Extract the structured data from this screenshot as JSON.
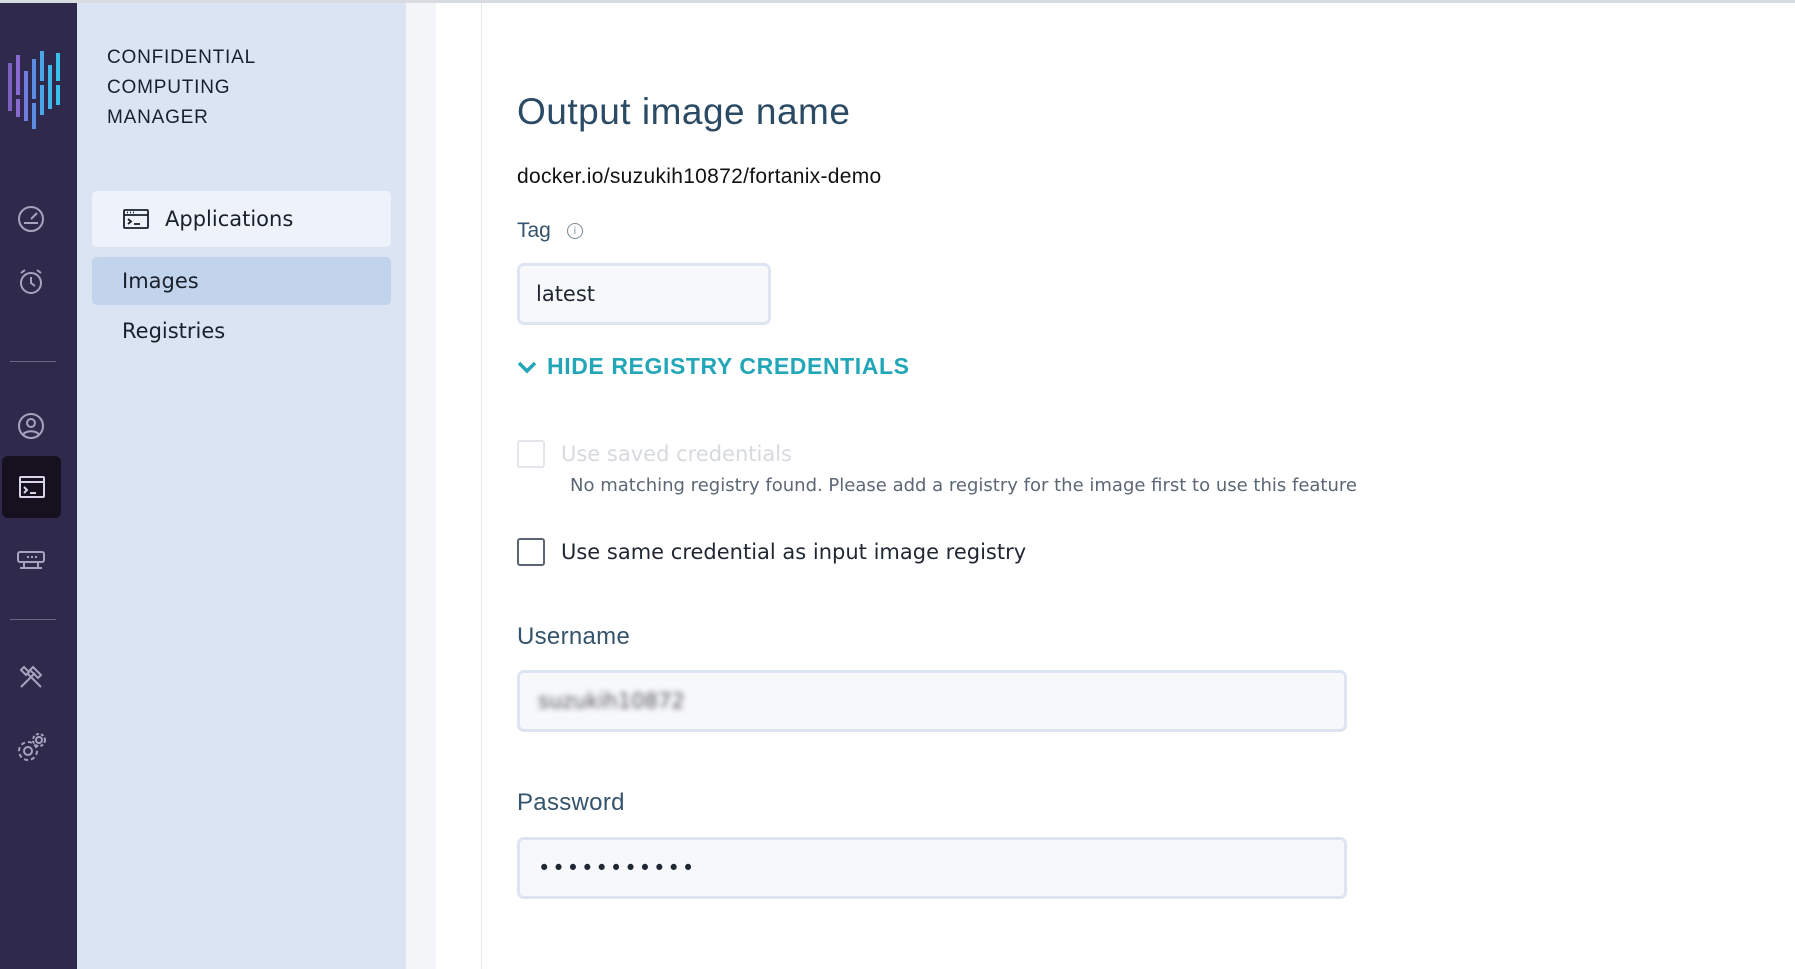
{
  "brand": {
    "lines": [
      "CONFIDENTIAL",
      "COMPUTING",
      "MANAGER"
    ]
  },
  "rail": {
    "icons": [
      "dashboard-icon",
      "alarm-icon",
      "user-icon",
      "applications-icon",
      "compute-node-icon",
      "tools-icon",
      "settings-icon"
    ],
    "active": "applications-icon"
  },
  "sidebar": {
    "items": [
      {
        "label": "Applications",
        "icon": "terminal-window-icon"
      },
      {
        "label": "Images",
        "selected": true
      },
      {
        "label": "Registries"
      }
    ]
  },
  "form": {
    "section_title": "Output image name",
    "repository": "docker.io/suzukih10872/fortanix-demo",
    "tag_label": "Tag",
    "tag_value": "latest",
    "toggle_label": "HIDE REGISTRY CREDENTIALS",
    "use_saved_label": "Use saved credentials",
    "use_saved_helper": "No matching registry found. Please add a registry for the image first to use this feature",
    "same_credential_label": "Use same credential as input image registry",
    "username_label": "Username",
    "username_value": "suzukih10872",
    "password_label": "Password",
    "password_value": "•••••••••••"
  },
  "colors": {
    "rail_bg": "#2f2a4b",
    "sidebar_bg": "#dbe4f3",
    "selected_item_bg": "#c2d3ec",
    "accent": "#23a7b8",
    "heading": "#2b4a63"
  }
}
